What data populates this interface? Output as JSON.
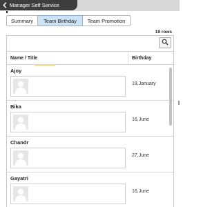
{
  "header": {
    "title": "Manager Self Service"
  },
  "tabs": [
    {
      "label": "Summary",
      "active": false
    },
    {
      "label": "Team Birthday",
      "active": true
    },
    {
      "label": "Team Promotion",
      "active": false
    }
  ],
  "grid": {
    "row_count": "19 rows",
    "columns": {
      "name": "Name / Title",
      "birthday": "Birthday"
    },
    "rows": [
      {
        "name": "Ajoy",
        "birthday": "19,January"
      },
      {
        "name": "Bika",
        "birthday": "16,June"
      },
      {
        "name": "Chandr",
        "birthday": "27,June"
      },
      {
        "name": "Gayatri",
        "birthday": "16,June"
      }
    ]
  },
  "icons": {
    "back": "chevron-left-icon",
    "search": "search-icon",
    "avatar": "person-avatar-icon"
  },
  "colors": {
    "header_bg": "#3d3d3d",
    "active_tab": "#cfe3f7",
    "border": "#c8c8c8"
  }
}
